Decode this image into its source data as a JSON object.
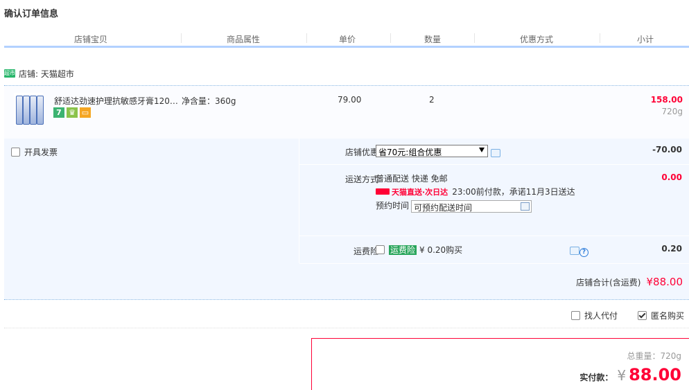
{
  "page_title": "确认订单信息",
  "columns": [
    "店铺宝贝",
    "商品属性",
    "单价",
    "数量",
    "优惠方式",
    "小计"
  ],
  "shop": {
    "logo_text": "超市",
    "label": "店铺: 天猫超市"
  },
  "item": {
    "name": "舒适达劲速护理抗敏感牙膏120…",
    "attribute": "净含量：360g",
    "unit_price": "79.00",
    "quantity": "2",
    "subtotal": "158.00",
    "weight": "720g",
    "badges": [
      {
        "text": "7",
        "color": "#3cb371"
      },
      {
        "text": "",
        "color": "#8bc34a"
      },
      {
        "text": "",
        "color": "#f5a623"
      }
    ]
  },
  "invoice": {
    "label": "开具发票",
    "checked": false
  },
  "discount": {
    "label": "店铺优惠:",
    "selected": "省70元:组合优惠",
    "amount": "-70.00"
  },
  "shipping": {
    "label": "运送方式:",
    "method": "普通配送 快递 免邮",
    "tmall_badge": "天猫直送·次日达",
    "promise": "23:00前付款，承诺11月3日送达",
    "reserve_label": "预约时间",
    "reserve_placeholder": "可预约配送时间",
    "amount": "0.00"
  },
  "insurance": {
    "label": "运费险:",
    "badge": "运费险",
    "price_text": "¥ 0.20购买",
    "amount": "0.20",
    "checked": false
  },
  "shop_total": {
    "label": "店铺合计(含运费)",
    "value": "¥88.00"
  },
  "options": {
    "proxy_pay": "找人代付",
    "proxy_checked": false,
    "anonymous": "匿名购买",
    "anonymous_checked": true
  },
  "summary": {
    "weight_text": "总重量：720g",
    "pay_label": "实付款：",
    "currency": "¥",
    "amount": "88.00"
  },
  "colors": {
    "accent": "#ff0036",
    "header_line": "#b2d1ff",
    "panel_bg": "#f2f7ff",
    "brand_green": "#28b66b"
  }
}
